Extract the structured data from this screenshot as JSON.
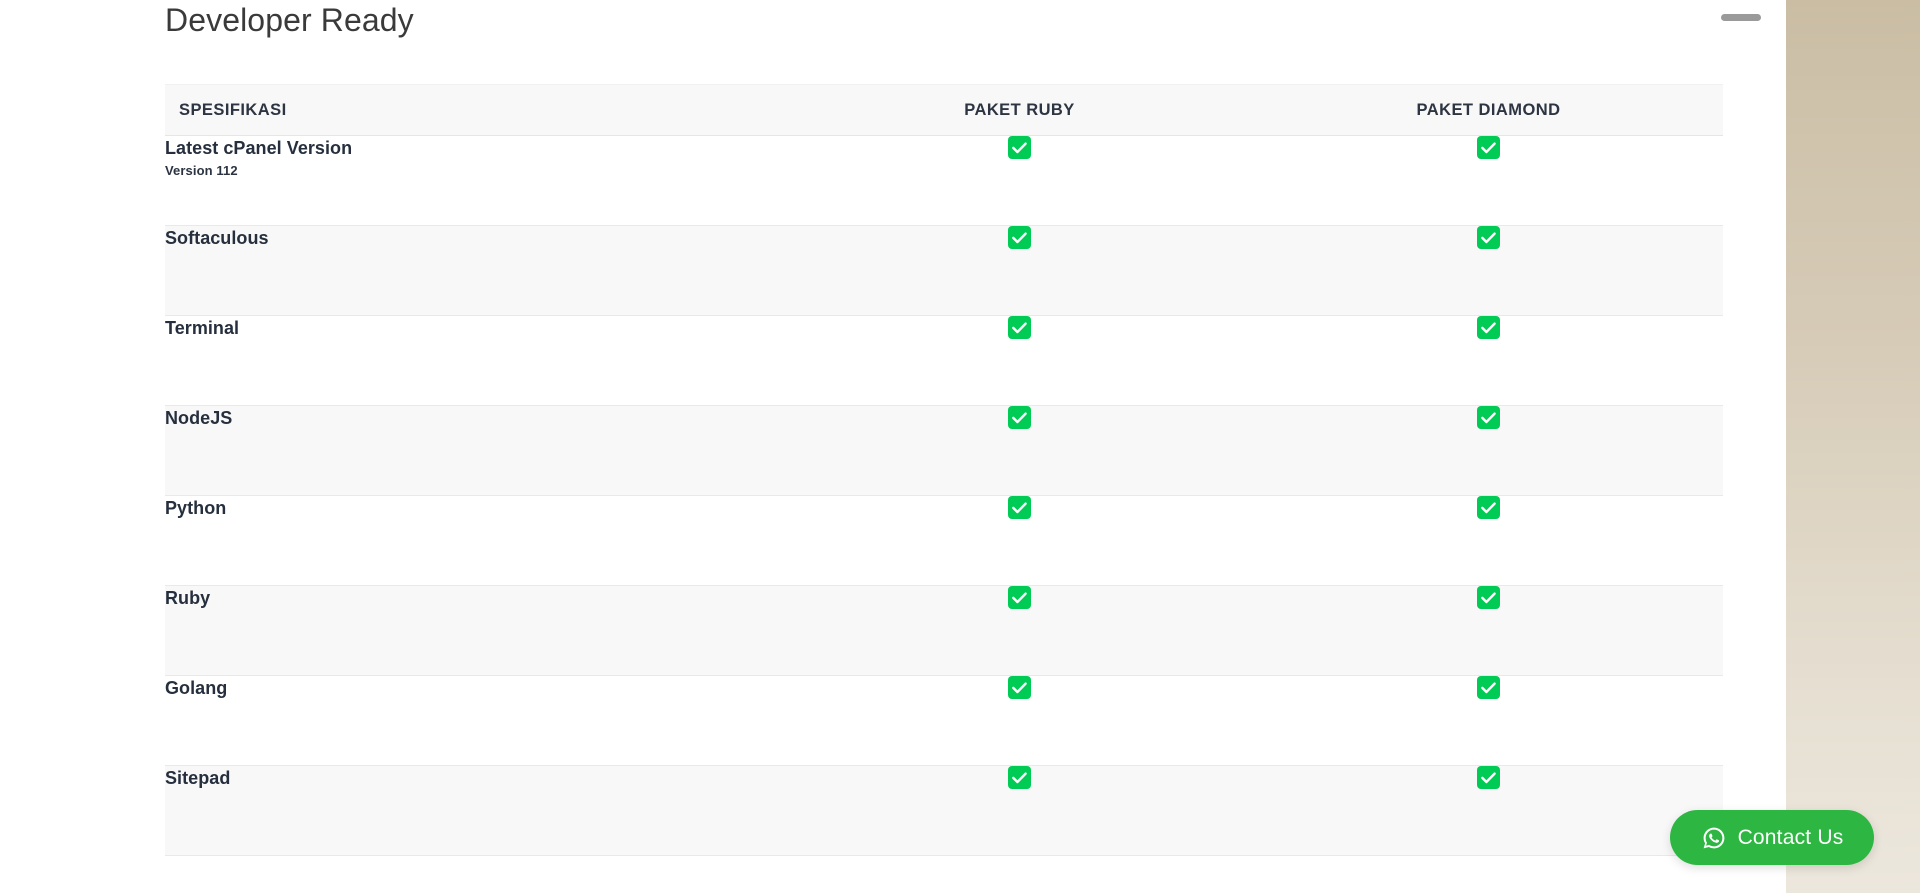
{
  "page": {
    "title": "Developer Ready"
  },
  "table": {
    "headers": {
      "spec": "SPESIFIKASI",
      "package_1": "PAKET RUBY",
      "package_2": "PAKET DIAMOND"
    },
    "rows": [
      {
        "name": "Latest cPanel Version",
        "sub": "Version 112",
        "ruby": "check",
        "diamond": "check"
      },
      {
        "name": "Softaculous",
        "sub": "",
        "ruby": "check",
        "diamond": "check"
      },
      {
        "name": "Terminal",
        "sub": "",
        "ruby": "check",
        "diamond": "check"
      },
      {
        "name": "NodeJS",
        "sub": "",
        "ruby": "check",
        "diamond": "check"
      },
      {
        "name": "Python",
        "sub": "",
        "ruby": "check",
        "diamond": "check"
      },
      {
        "name": "Ruby",
        "sub": "",
        "ruby": "check",
        "diamond": "check"
      },
      {
        "name": "Golang",
        "sub": "",
        "ruby": "check",
        "diamond": "check"
      },
      {
        "name": "Sitepad",
        "sub": "",
        "ruby": "check",
        "diamond": "check"
      }
    ]
  },
  "contact": {
    "label": "Contact Us",
    "icon": "whatsapp-icon"
  },
  "colors": {
    "check_green": "#00cc55",
    "whatsapp_green": "#2db742",
    "header_bg": "#f8f8f8",
    "stripe_bg": "#f8f8f8",
    "text_dark": "#262f3d",
    "title_grey": "#3a3a3a",
    "side_panel_top": "#cabda4",
    "side_panel_bottom": "#ece7dd",
    "scroll_pill": "#9a9a9a"
  }
}
